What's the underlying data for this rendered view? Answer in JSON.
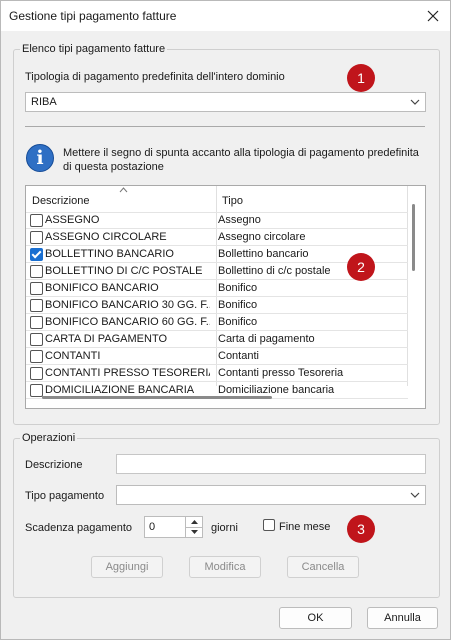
{
  "window": {
    "title": "Gestione tipi pagamento fatture"
  },
  "group1": {
    "title": "Elenco tipi pagamento fatture"
  },
  "default_type": {
    "label": "Tipologia di pagamento predefinita dell'intero dominio",
    "value": "RIBA"
  },
  "info": {
    "text": "Mettere il segno di spunta accanto alla tipologia di pagamento predefinita di questa postazione"
  },
  "list": {
    "columns": [
      "Descrizione",
      "Tipo"
    ],
    "rows": [
      {
        "descrizione": "ASSEGNO",
        "tipo": "Assegno",
        "checked": false
      },
      {
        "descrizione": "ASSEGNO CIRCOLARE",
        "tipo": "Assegno circolare",
        "checked": false
      },
      {
        "descrizione": "BOLLETTINO BANCARIO",
        "tipo": "Bollettino bancario",
        "checked": true
      },
      {
        "descrizione": "BOLLETTINO DI C/C POSTALE",
        "tipo": "Bollettino di c/c postale",
        "checked": false
      },
      {
        "descrizione": "BONIFICO BANCARIO",
        "tipo": "Bonifico",
        "checked": false
      },
      {
        "descrizione": "BONIFICO BANCARIO 30 GG. F...",
        "tipo": "Bonifico",
        "checked": false
      },
      {
        "descrizione": "BONIFICO BANCARIO 60 GG. F...",
        "tipo": "Bonifico",
        "checked": false
      },
      {
        "descrizione": "CARTA DI PAGAMENTO",
        "tipo": "Carta di pagamento",
        "checked": false
      },
      {
        "descrizione": "CONTANTI",
        "tipo": "Contanti",
        "checked": false
      },
      {
        "descrizione": "CONTANTI PRESSO TESORERIA",
        "tipo": "Contanti presso Tesoreria",
        "checked": false
      },
      {
        "descrizione": "DOMICILIAZIONE BANCARIA",
        "tipo": "Domiciliazione bancaria",
        "checked": false
      }
    ]
  },
  "badges": [
    "1",
    "2",
    "3"
  ],
  "group2": {
    "title": "Operazioni"
  },
  "form": {
    "descrizione_label": "Descrizione",
    "descrizione_value": "",
    "tipo_label": "Tipo pagamento",
    "tipo_value": "",
    "scadenza_label": "Scadenza pagamento",
    "scadenza_value": "0",
    "giorni_label": "giorni",
    "fine_mese_label": "Fine mese",
    "fine_mese_checked": false
  },
  "actions": {
    "add": "Aggiungi",
    "edit": "Modifica",
    "delete": "Cancella"
  },
  "footer": {
    "ok": "OK",
    "cancel": "Annulla"
  },
  "colors": {
    "badge": "#c0151b",
    "check_accent": "#1a6fd1",
    "info_icon": "#2f6fc4"
  }
}
